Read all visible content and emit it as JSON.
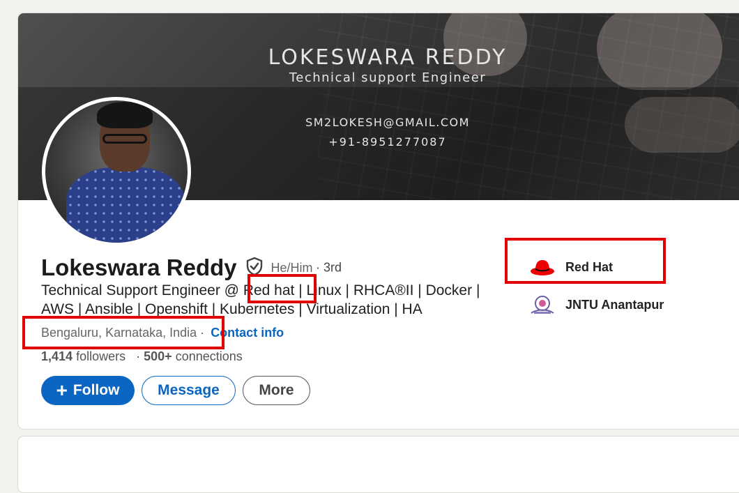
{
  "banner": {
    "name": "LOKESWARA REDDY",
    "title": "Technical support Engineer",
    "email": "SM2LOKESH@GMAIL.COM",
    "phone": "+91-8951277087"
  },
  "profile": {
    "name": "Lokeswara Reddy",
    "pronouns": "He/Him",
    "degree": "· 3rd",
    "headline": "Technical Support Engineer @ Red hat | Linux | RHCA®II | Docker | AWS | Ansible | Openshift | Kubernetes | Virtualization | HA",
    "location": "Bengaluru, Karnataka, India",
    "separator": "·",
    "contact_label": "Contact info",
    "followers_count": "1,414",
    "followers_label": "followers",
    "connections_prefix": "·",
    "connections_count": "500+",
    "connections_label": "connections"
  },
  "actions": {
    "follow_icon": "+",
    "follow_label": "Follow",
    "message_label": "Message",
    "more_label": "More"
  },
  "organizations": [
    {
      "name": "Red Hat",
      "icon": "redhat-hat-icon",
      "color": "#ee0000"
    },
    {
      "name": "JNTU Anantapur",
      "icon": "jntu-emblem-icon",
      "color": "#6b5cab"
    }
  ],
  "colors": {
    "primary": "#0a66c2",
    "highlight": "#e00000"
  }
}
